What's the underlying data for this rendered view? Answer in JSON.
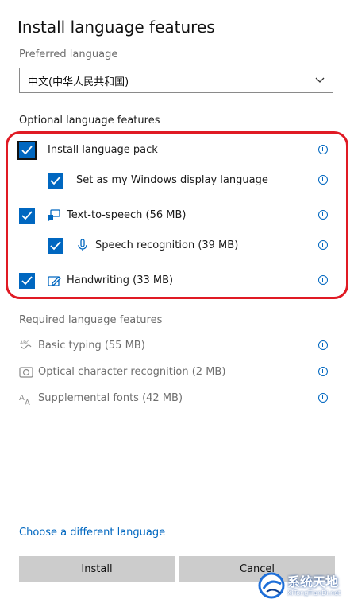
{
  "dialog": {
    "title": "Install language features",
    "preferred_label": "Preferred language",
    "preferred_value": "中文(中华人民共和国)",
    "optional_label": "Optional language features",
    "required_label": "Required language features",
    "change_link": "Choose a different language",
    "install_label": "Install",
    "cancel_label": "Cancel"
  },
  "optional_features": [
    {
      "label": "Install language pack",
      "checked": true,
      "icon": "none"
    },
    {
      "label": "Set as my Windows display language",
      "checked": true,
      "icon": "none"
    },
    {
      "label": "Text-to-speech (56 MB)",
      "checked": true,
      "icon": "speech-bubble-icon"
    },
    {
      "label": "Speech recognition (39 MB)",
      "checked": true,
      "icon": "microphone-icon"
    },
    {
      "label": "Handwriting (33 MB)",
      "checked": true,
      "icon": "pen-icon"
    }
  ],
  "required_features": [
    {
      "label": "Basic typing (55 MB)",
      "icon": "abc-keyboard-icon"
    },
    {
      "label": "Optical character recognition (2 MB)",
      "icon": "camera-scan-icon"
    },
    {
      "label": "Supplemental fonts (42 MB)",
      "icon": "font-icon"
    }
  ],
  "watermark": {
    "text": "系统天地",
    "sub": "XiTongTianDi.net"
  },
  "colors": {
    "accent": "#0067c0",
    "highlight_border": "#e01a24",
    "button_bg": "#cccccc"
  }
}
